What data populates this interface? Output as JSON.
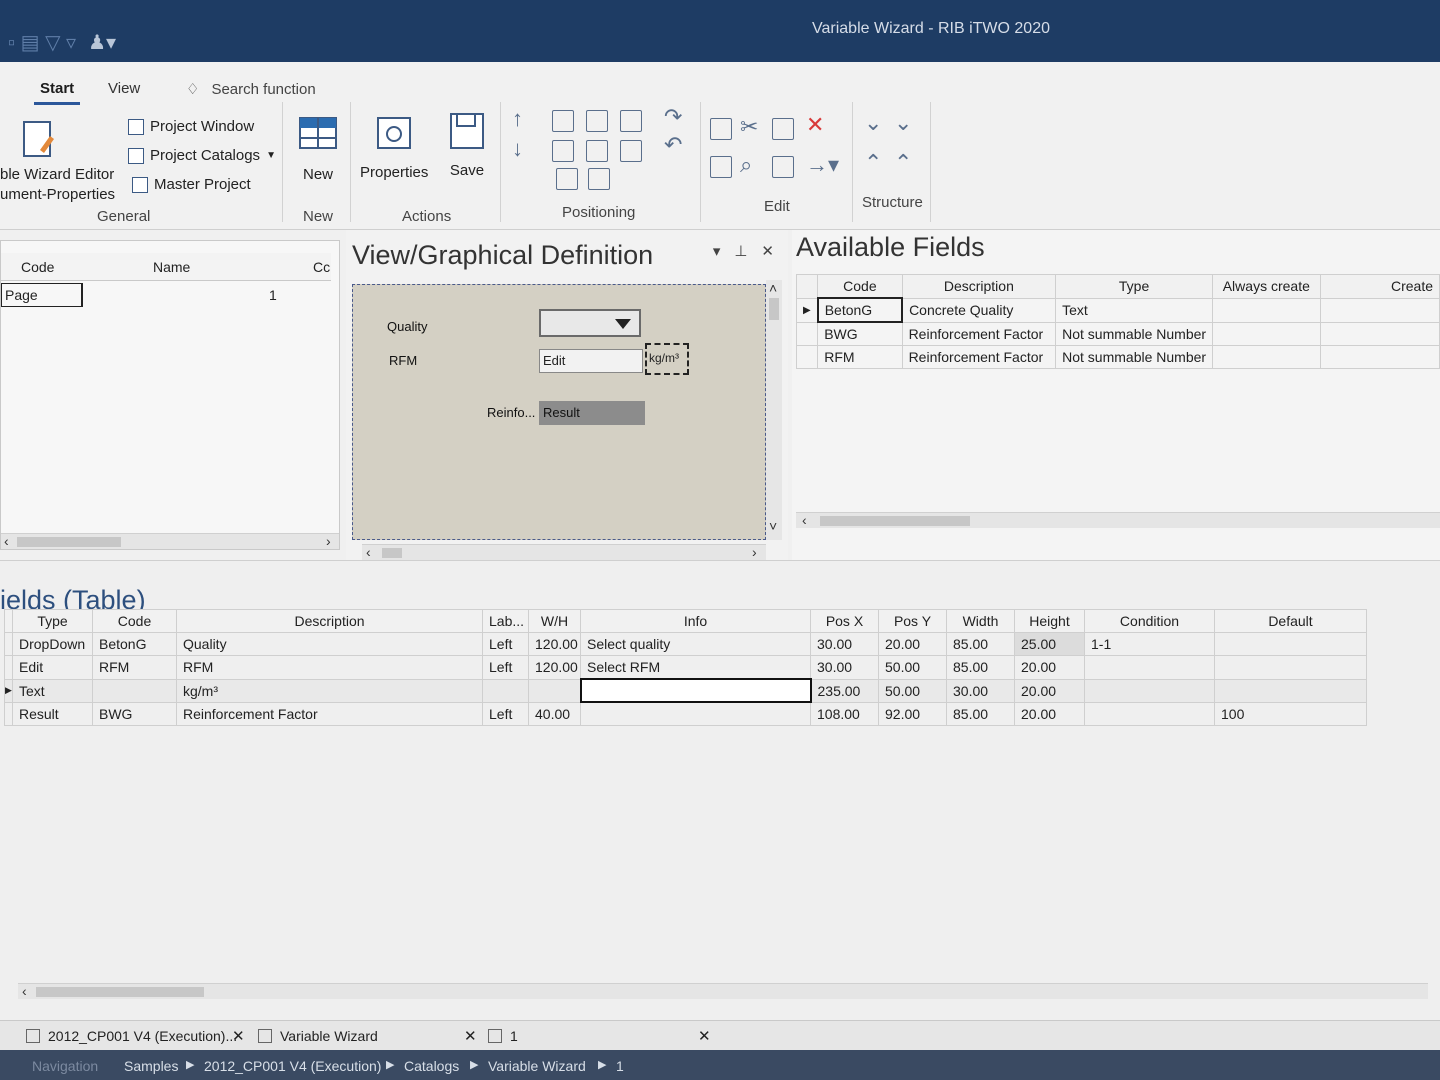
{
  "app": {
    "title": "Variable Wizard - RIB iTWO 2020"
  },
  "ribbon": {
    "tabs": [
      "Start",
      "View"
    ],
    "search": "Search function",
    "general": {
      "big_label_1": "ble Wizard Editor",
      "big_label_2": "ument-Properties",
      "items": [
        "Project Window",
        "Project Catalogs",
        "Master Project"
      ],
      "label": "General"
    },
    "new": {
      "button": "New",
      "label": "New"
    },
    "actions": {
      "properties": "Properties",
      "save": "Save",
      "label": "Actions"
    },
    "positioning": {
      "label": "Positioning"
    },
    "edit": {
      "label": "Edit"
    },
    "structure": {
      "label": "Structure"
    }
  },
  "left_panel": {
    "columns": [
      "Code",
      "Name",
      "Cc"
    ],
    "rows": [
      {
        "code": "Page",
        "name": "",
        "c": "1"
      }
    ]
  },
  "view_panel": {
    "title": "View/Graphical Definition",
    "labels": {
      "quality": "Quality",
      "rfm": "RFM",
      "reinfo": "Reinfo..."
    },
    "edit_value": "Edit",
    "unit_value": "kg/m³",
    "result_value": "Result"
  },
  "available_fields": {
    "title": "Available Fields",
    "columns": [
      "Code",
      "Description",
      "Type",
      "Always create",
      "Create"
    ],
    "rows": [
      {
        "code": "BetonG",
        "description": "Concrete Quality",
        "type": "Text"
      },
      {
        "code": "BWG",
        "description": "Reinforcement Factor",
        "type": "Not summable Number"
      },
      {
        "code": "RFM",
        "description": "Reinforcement Factor",
        "type": "Not summable Number"
      }
    ]
  },
  "fields_table": {
    "title": "ields (Table)",
    "columns": [
      "Type",
      "Code",
      "Description",
      "Lab...",
      "W/H",
      "Info",
      "Pos X",
      "Pos Y",
      "Width",
      "Height",
      "Condition",
      "Default"
    ],
    "rows": [
      {
        "type": "DropDown",
        "code": "BetonG",
        "description": "Quality",
        "lab": "Left",
        "wh": "120.00",
        "info": "Select quality",
        "posx": "30.00",
        "posy": "20.00",
        "width": "85.00",
        "height": "25.00",
        "condition": "1-1",
        "default": ""
      },
      {
        "type": "Edit",
        "code": "RFM",
        "description": "RFM",
        "lab": "Left",
        "wh": "120.00",
        "info": "Select RFM",
        "posx": "30.00",
        "posy": "50.00",
        "width": "85.00",
        "height": "20.00",
        "condition": "",
        "default": ""
      },
      {
        "type": "Text",
        "code": "",
        "description": "kg/m³",
        "lab": "",
        "wh": "",
        "info": "",
        "posx": "235.00",
        "posy": "50.00",
        "width": "30.00",
        "height": "20.00",
        "condition": "",
        "default": ""
      },
      {
        "type": "Result",
        "code": "BWG",
        "description": "Reinforcement Factor",
        "lab": "Left",
        "wh": "40.00",
        "info": "",
        "posx": "108.00",
        "posy": "92.00",
        "width": "85.00",
        "height": "20.00",
        "condition": "",
        "default": "100"
      }
    ]
  },
  "doc_tabs": [
    "2012_CP001 V4 (Execution)...",
    "Variable Wizard",
    "1"
  ],
  "statusbar": {
    "navigation": "Navigation",
    "crumbs": [
      "Samples",
      "2012_CP001 V4 (Execution)",
      "Catalogs",
      "Variable Wizard",
      "1"
    ]
  }
}
